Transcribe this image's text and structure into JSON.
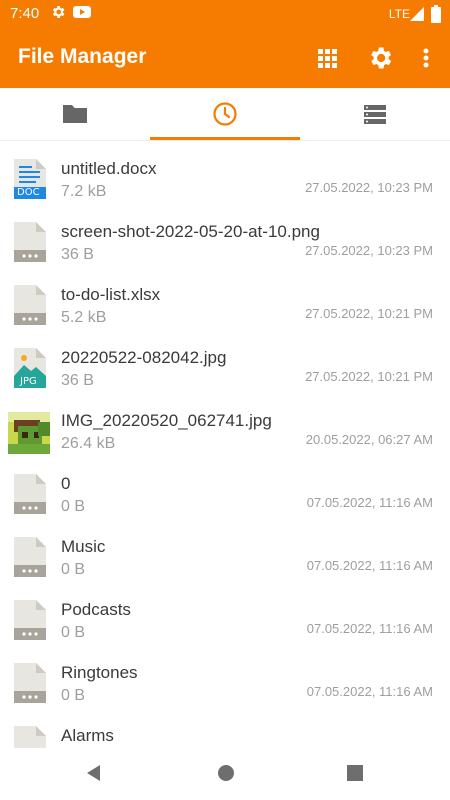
{
  "status_bar": {
    "time": "7:40",
    "network": "LTE",
    "icons": [
      "settings-icon",
      "youtube-icon",
      "signal-icon",
      "battery-icon"
    ]
  },
  "app_bar": {
    "title": "File Manager",
    "actions": [
      "grid-view-icon",
      "settings-icon",
      "more-vert-icon"
    ]
  },
  "tabs": [
    {
      "icon": "folder-icon",
      "selected": false
    },
    {
      "icon": "clock-icon",
      "selected": true
    },
    {
      "icon": "storage-icon",
      "selected": false
    }
  ],
  "files": [
    {
      "name": "untitled.docx",
      "size": "7.2 kB",
      "date": "27.05.2022, 10:23 PM",
      "icon": "doc-file-icon",
      "badge": "DOC"
    },
    {
      "name": "screen-shot-2022-05-20-at-10.png",
      "size": "36 B",
      "date": "27.05.2022, 10:23 PM",
      "icon": "generic-file-icon"
    },
    {
      "name": "to-do-list.xlsx",
      "size": "5.2 kB",
      "date": "27.05.2022, 10:21 PM",
      "icon": "generic-file-icon"
    },
    {
      "name": "20220522-082042.jpg",
      "size": "36 B",
      "date": "27.05.2022, 10:21 PM",
      "icon": "jpg-file-icon",
      "badge": "JPG"
    },
    {
      "name": "IMG_20220520_062741.jpg",
      "size": "26.4 kB",
      "date": "20.05.2022, 06:27 AM",
      "icon": "image-thumbnail"
    },
    {
      "name": "0",
      "size": "0 B",
      "date": "07.05.2022, 11:16 AM",
      "icon": "generic-file-icon"
    },
    {
      "name": "Music",
      "size": "0 B",
      "date": "07.05.2022, 11:16 AM",
      "icon": "generic-file-icon"
    },
    {
      "name": "Podcasts",
      "size": "0 B",
      "date": "07.05.2022, 11:16 AM",
      "icon": "generic-file-icon"
    },
    {
      "name": "Ringtones",
      "size": "0 B",
      "date": "07.05.2022, 11:16 AM",
      "icon": "generic-file-icon"
    },
    {
      "name": "Alarms",
      "size": "",
      "date": "",
      "icon": "generic-file-icon"
    }
  ],
  "nav_bar": [
    "back-icon",
    "home-icon",
    "recents-icon"
  ],
  "colors": {
    "accent": "#F57C00",
    "text": "#3a3a3a",
    "muted": "#9e9e9e"
  }
}
